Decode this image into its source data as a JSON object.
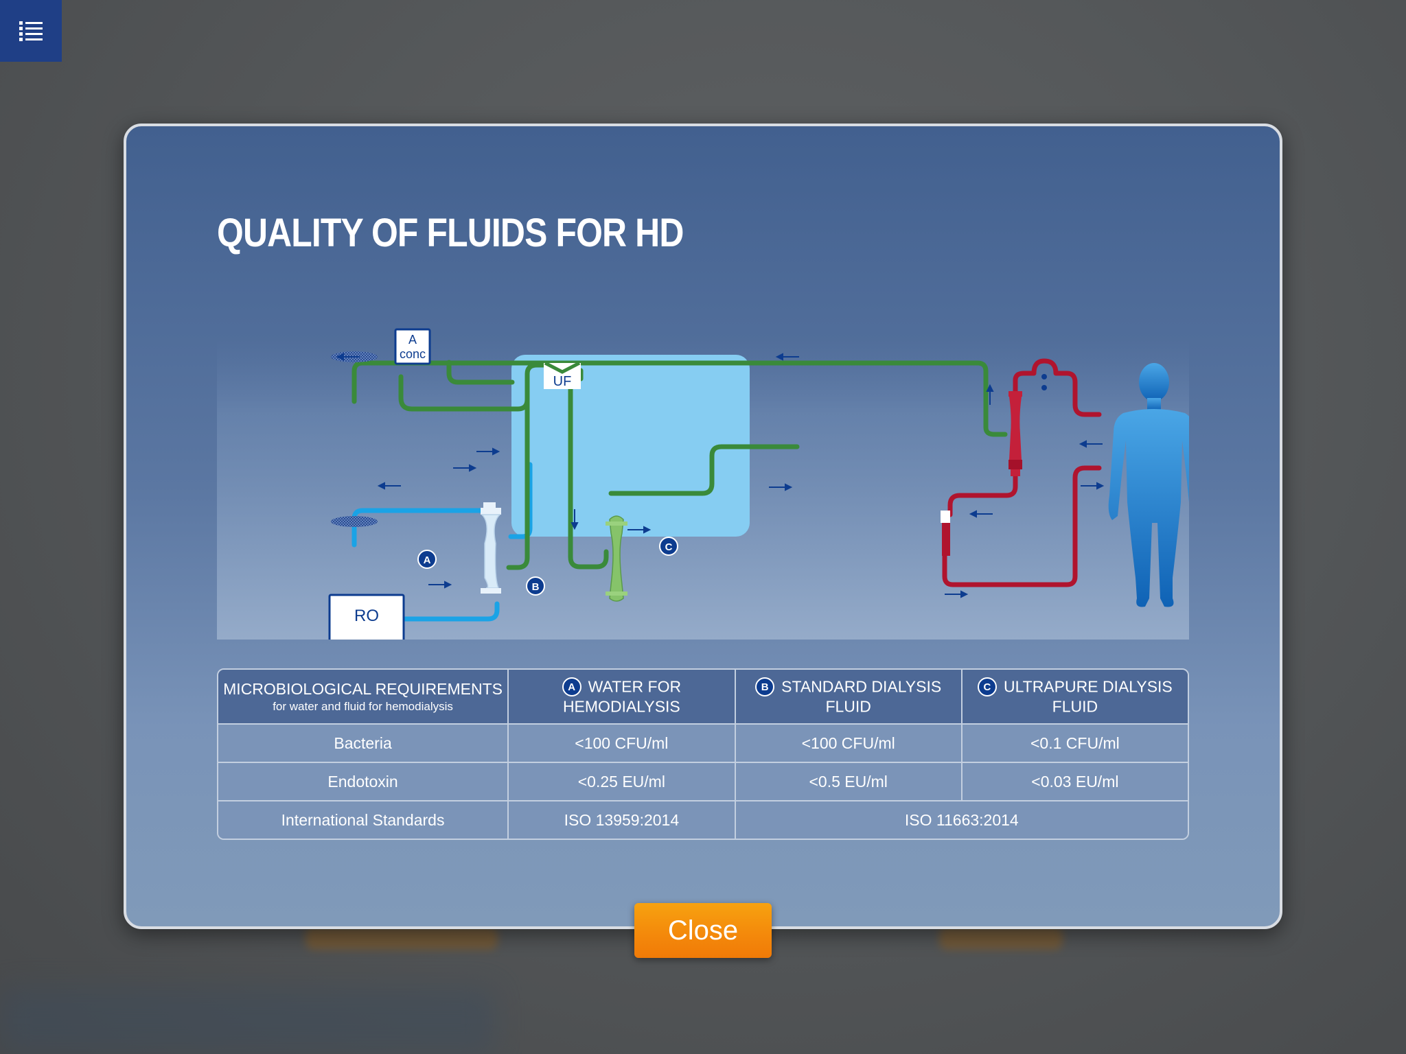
{
  "modal": {
    "title": "QUALITY OF FLUIDS FOR HD",
    "close_label": "Close"
  },
  "diagram": {
    "labels": {
      "uf": "UF",
      "acid_conc_line1": "A",
      "acid_conc_line2": "conc",
      "ro": "RO",
      "marker_a": "A",
      "marker_b": "B",
      "marker_c": "C"
    },
    "colors": {
      "water_blue": "#1aa3e6",
      "dialysate_green": "#3a8a3a",
      "blood_red": "#b0142e",
      "machine_panel": "#86cdf2",
      "marker_navy": "#0d3c8f"
    }
  },
  "table": {
    "header": {
      "col0_main": "MICROBIOLOGICAL REQUIREMENTS",
      "col0_sub": "for water and fluid for hemodialysis",
      "col1_badge": "A",
      "col1": "WATER FOR HEMODIALYSIS",
      "col2_badge": "B",
      "col2": "STANDARD DIALYSIS FLUID",
      "col3_badge": "C",
      "col3": "ULTRAPURE DIALYSIS FLUID"
    },
    "rows": [
      {
        "label": "Bacteria",
        "a": "<100 CFU/ml",
        "b": "<100 CFU/ml",
        "c": "<0.1 CFU/ml"
      },
      {
        "label": "Endotoxin",
        "a": "<0.25 EU/ml",
        "b": "<0.5 EU/ml",
        "c": "<0.03 EU/ml"
      },
      {
        "label": "International Standards",
        "a": "ISO 13959:2014",
        "bc": "ISO 11663:2014"
      }
    ]
  }
}
